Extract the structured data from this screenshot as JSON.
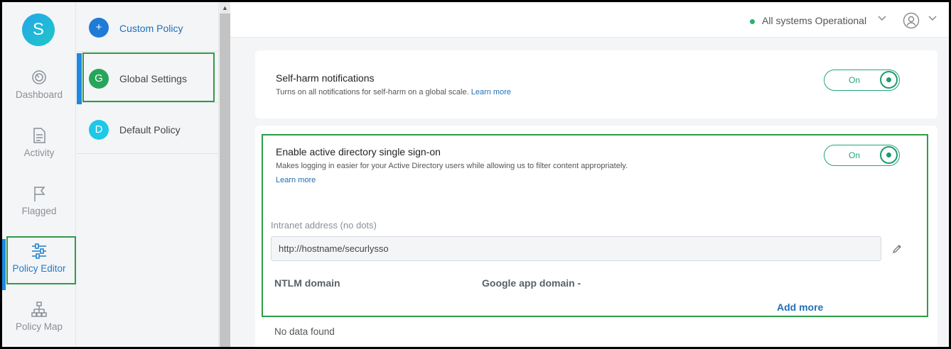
{
  "app": {
    "logo_letter": "S",
    "brand_gradient": [
      "#24a6e8",
      "#1ec8c8"
    ],
    "accent_color": "#1e88e5",
    "toggle_color": "#23a57a"
  },
  "nav": {
    "items": [
      {
        "label": "Dashboard",
        "icon": "dashboard-gauge-icon",
        "active": false
      },
      {
        "label": "Activity",
        "icon": "activity-document-icon",
        "active": false
      },
      {
        "label": "Flagged",
        "icon": "flag-icon",
        "active": false
      },
      {
        "label": "Policy Editor",
        "icon": "sliders-icon",
        "active": true
      },
      {
        "label": "Policy Map",
        "icon": "sitemap-icon",
        "active": false
      }
    ]
  },
  "policies": {
    "items": [
      {
        "badge": "+",
        "label": "Custom Policy",
        "color": "#1e7bd6"
      },
      {
        "badge": "G",
        "label": "Global Settings",
        "color": "#25a65a",
        "selected": true
      },
      {
        "badge": "D",
        "label": "Default Policy",
        "color": "#1ec8e6"
      }
    ]
  },
  "header": {
    "status_text": "All systems Operational",
    "status_color": "#27b36b"
  },
  "settings": {
    "self_harm": {
      "title": "Self-harm notifications",
      "description": "Turns on all notifications for self-harm on a global scale.",
      "learn_more": "Learn more",
      "toggle_label": "On"
    },
    "sso": {
      "title": "Enable active directory single sign-on",
      "description": "Makes logging in easier for your Active Directory users while allowing us to filter content appropriately.",
      "learn_more": "Learn more",
      "toggle_label": "On",
      "intranet_label": "Intranet address (no dots)",
      "intranet_value": "http://hostname/securlysso",
      "ntlm_label": "NTLM domain",
      "google_label": "Google app domain -",
      "add_more": "Add more",
      "no_data": "No data found"
    }
  }
}
